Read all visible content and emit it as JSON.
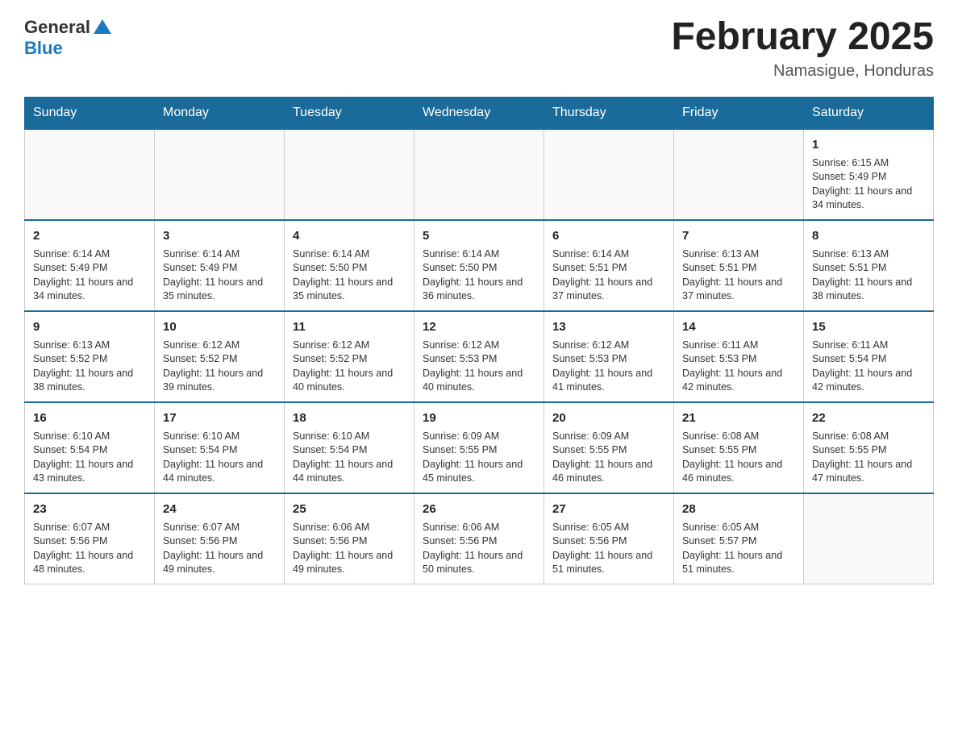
{
  "header": {
    "logo_general": "General",
    "logo_blue": "Blue",
    "month_title": "February 2025",
    "location": "Namasigue, Honduras"
  },
  "days_of_week": [
    "Sunday",
    "Monday",
    "Tuesday",
    "Wednesday",
    "Thursday",
    "Friday",
    "Saturday"
  ],
  "weeks": [
    {
      "cells": [
        {
          "day": "",
          "info": ""
        },
        {
          "day": "",
          "info": ""
        },
        {
          "day": "",
          "info": ""
        },
        {
          "day": "",
          "info": ""
        },
        {
          "day": "",
          "info": ""
        },
        {
          "day": "",
          "info": ""
        },
        {
          "day": "1",
          "info": "Sunrise: 6:15 AM\nSunset: 5:49 PM\nDaylight: 11 hours and 34 minutes."
        }
      ]
    },
    {
      "cells": [
        {
          "day": "2",
          "info": "Sunrise: 6:14 AM\nSunset: 5:49 PM\nDaylight: 11 hours and 34 minutes."
        },
        {
          "day": "3",
          "info": "Sunrise: 6:14 AM\nSunset: 5:49 PM\nDaylight: 11 hours and 35 minutes."
        },
        {
          "day": "4",
          "info": "Sunrise: 6:14 AM\nSunset: 5:50 PM\nDaylight: 11 hours and 35 minutes."
        },
        {
          "day": "5",
          "info": "Sunrise: 6:14 AM\nSunset: 5:50 PM\nDaylight: 11 hours and 36 minutes."
        },
        {
          "day": "6",
          "info": "Sunrise: 6:14 AM\nSunset: 5:51 PM\nDaylight: 11 hours and 37 minutes."
        },
        {
          "day": "7",
          "info": "Sunrise: 6:13 AM\nSunset: 5:51 PM\nDaylight: 11 hours and 37 minutes."
        },
        {
          "day": "8",
          "info": "Sunrise: 6:13 AM\nSunset: 5:51 PM\nDaylight: 11 hours and 38 minutes."
        }
      ]
    },
    {
      "cells": [
        {
          "day": "9",
          "info": "Sunrise: 6:13 AM\nSunset: 5:52 PM\nDaylight: 11 hours and 38 minutes."
        },
        {
          "day": "10",
          "info": "Sunrise: 6:12 AM\nSunset: 5:52 PM\nDaylight: 11 hours and 39 minutes."
        },
        {
          "day": "11",
          "info": "Sunrise: 6:12 AM\nSunset: 5:52 PM\nDaylight: 11 hours and 40 minutes."
        },
        {
          "day": "12",
          "info": "Sunrise: 6:12 AM\nSunset: 5:53 PM\nDaylight: 11 hours and 40 minutes."
        },
        {
          "day": "13",
          "info": "Sunrise: 6:12 AM\nSunset: 5:53 PM\nDaylight: 11 hours and 41 minutes."
        },
        {
          "day": "14",
          "info": "Sunrise: 6:11 AM\nSunset: 5:53 PM\nDaylight: 11 hours and 42 minutes."
        },
        {
          "day": "15",
          "info": "Sunrise: 6:11 AM\nSunset: 5:54 PM\nDaylight: 11 hours and 42 minutes."
        }
      ]
    },
    {
      "cells": [
        {
          "day": "16",
          "info": "Sunrise: 6:10 AM\nSunset: 5:54 PM\nDaylight: 11 hours and 43 minutes."
        },
        {
          "day": "17",
          "info": "Sunrise: 6:10 AM\nSunset: 5:54 PM\nDaylight: 11 hours and 44 minutes."
        },
        {
          "day": "18",
          "info": "Sunrise: 6:10 AM\nSunset: 5:54 PM\nDaylight: 11 hours and 44 minutes."
        },
        {
          "day": "19",
          "info": "Sunrise: 6:09 AM\nSunset: 5:55 PM\nDaylight: 11 hours and 45 minutes."
        },
        {
          "day": "20",
          "info": "Sunrise: 6:09 AM\nSunset: 5:55 PM\nDaylight: 11 hours and 46 minutes."
        },
        {
          "day": "21",
          "info": "Sunrise: 6:08 AM\nSunset: 5:55 PM\nDaylight: 11 hours and 46 minutes."
        },
        {
          "day": "22",
          "info": "Sunrise: 6:08 AM\nSunset: 5:55 PM\nDaylight: 11 hours and 47 minutes."
        }
      ]
    },
    {
      "cells": [
        {
          "day": "23",
          "info": "Sunrise: 6:07 AM\nSunset: 5:56 PM\nDaylight: 11 hours and 48 minutes."
        },
        {
          "day": "24",
          "info": "Sunrise: 6:07 AM\nSunset: 5:56 PM\nDaylight: 11 hours and 49 minutes."
        },
        {
          "day": "25",
          "info": "Sunrise: 6:06 AM\nSunset: 5:56 PM\nDaylight: 11 hours and 49 minutes."
        },
        {
          "day": "26",
          "info": "Sunrise: 6:06 AM\nSunset: 5:56 PM\nDaylight: 11 hours and 50 minutes."
        },
        {
          "day": "27",
          "info": "Sunrise: 6:05 AM\nSunset: 5:56 PM\nDaylight: 11 hours and 51 minutes."
        },
        {
          "day": "28",
          "info": "Sunrise: 6:05 AM\nSunset: 5:57 PM\nDaylight: 11 hours and 51 minutes."
        },
        {
          "day": "",
          "info": ""
        }
      ]
    }
  ]
}
